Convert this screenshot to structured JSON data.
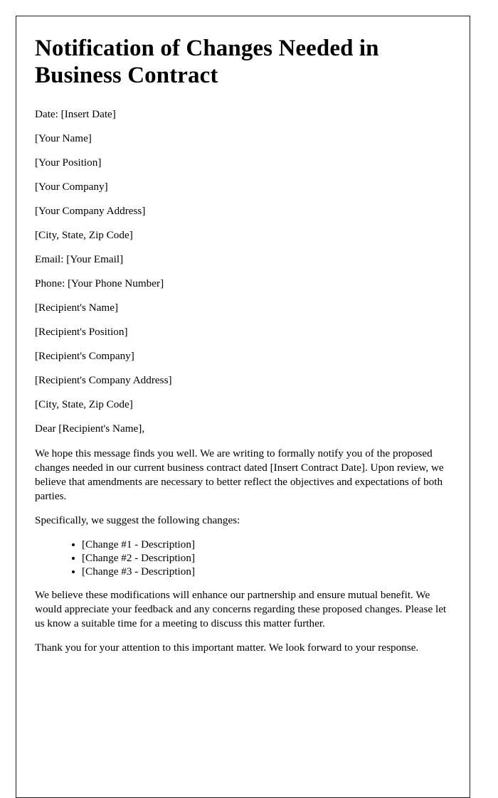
{
  "document": {
    "title": "Notification of Changes Needed in Business Contract",
    "date_line": "Date: [Insert Date]",
    "sender": {
      "name": "[Your Name]",
      "position": "[Your Position]",
      "company": "[Your Company]",
      "address": "[Your Company Address]",
      "city_state_zip": "[City, State, Zip Code]",
      "email": "Email: [Your Email]",
      "phone": "Phone: [Your Phone Number]"
    },
    "recipient": {
      "name": "[Recipient's Name]",
      "position": "[Recipient's Position]",
      "company": "[Recipient's Company]",
      "address": "[Recipient's Company Address]",
      "city_state_zip": "[City, State, Zip Code]"
    },
    "salutation": "Dear [Recipient's Name],",
    "paragraph_intro": "We hope this message finds you well. We are writing to formally notify you of the proposed changes needed in our current business contract dated [Insert Contract Date]. Upon review, we believe that amendments are necessary to better reflect the objectives and expectations of both parties.",
    "paragraph_lead_in": "Specifically, we suggest the following changes:",
    "changes": [
      "[Change #1 - Description]",
      "[Change #2 - Description]",
      "[Change #3 - Description]"
    ],
    "paragraph_benefit": "We believe these modifications will enhance our partnership and ensure mutual benefit. We would appreciate your feedback and any concerns regarding these proposed changes. Please let us know a suitable time for a meeting to discuss this matter further.",
    "paragraph_closing": "Thank you for your attention to this important matter. We look forward to your response."
  },
  "colors": {
    "page_background": "#ffffff",
    "page_border": "#1b1b1b",
    "text": "#000000"
  }
}
